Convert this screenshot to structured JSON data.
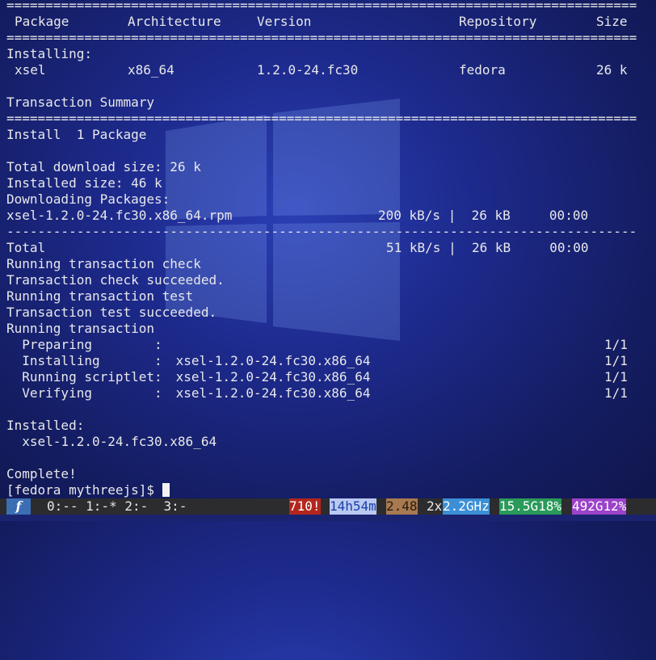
{
  "table": {
    "rule_double": "==============================================================================================================================",
    "rule_single": "------------------------------------------------------------------------------------------------------------------------------",
    "headers": [
      "Package",
      "Architecture",
      "Version",
      "Repository",
      "Size"
    ],
    "installing_label": "Installing:",
    "row": [
      "xsel",
      "x86_64",
      "1.2.0-24.fc30",
      "fedora",
      "26 k"
    ]
  },
  "summary": {
    "title": "Transaction Summary",
    "install_line": "Install  1 Package",
    "download_size": "Total download size: 26 k",
    "installed_size": "Installed size: 46 k",
    "downloading": "Downloading Packages:",
    "pkg_file": "xsel-1.2.0-24.fc30.x86_64.rpm",
    "pkg_rate": "200 kB/s |  26 kB     00:00",
    "total_label": "Total",
    "total_rate": "51 kB/s |  26 kB     00:00"
  },
  "transaction": {
    "lines": [
      "Running transaction check",
      "Transaction check succeeded.",
      "Running transaction test",
      "Transaction test succeeded.",
      "Running transaction"
    ],
    "steps": [
      {
        "label": "  Preparing        :",
        "pkg": "",
        "count": "1/1"
      },
      {
        "label": "  Installing       :",
        "pkg": " xsel-1.2.0-24.fc30.x86_64",
        "count": "1/1"
      },
      {
        "label": "  Running scriptlet:",
        "pkg": " xsel-1.2.0-24.fc30.x86_64",
        "count": "1/1"
      },
      {
        "label": "  Verifying        :",
        "pkg": " xsel-1.2.0-24.fc30.x86_64",
        "count": "1/1"
      }
    ],
    "installed_label": "Installed:",
    "installed_pkg": "  xsel-1.2.0-24.fc30.x86_64",
    "complete": "Complete!",
    "prompt": "[fedora mythreejs]$ "
  },
  "statusbar": {
    "os_glyph": "f",
    "windows": "0:-- 1:-* 2:-  3:-",
    "alerts": "710!",
    "uptime": "14h54m",
    "load": "2.48",
    "cpu_count": "2x",
    "cpu_freq": "2.2GHz",
    "mem": "15.5G18%",
    "disk": "492G12%"
  },
  "colors": {
    "background": "#1d2a8c",
    "fedora_blue": "#3c6eb4",
    "alert_red": "#b3261e",
    "disk_purple": "#9b42c9",
    "mem_green": "#2a9a5a"
  }
}
